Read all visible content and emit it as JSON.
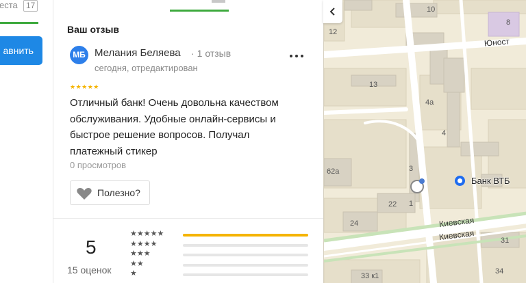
{
  "left_panel": {
    "tab_label": "еста",
    "tab_count": "17",
    "action_button": "авнить"
  },
  "review": {
    "section_title": "Ваш отзыв",
    "avatar_initials": "МБ",
    "author": "Мелания Беляева",
    "reviews_count": "1 отзыв",
    "date": "сегодня, отредактирован",
    "rating_stars": "★★★★★",
    "text": "Отличный банк! Очень довольна качеством обслуживания. Удобные онлайн-сервисы и быстрое решение вопросов. Получал платежный стикер",
    "views": "0 просмотров",
    "useful_button": "Полезно?"
  },
  "rating_summary": {
    "value": "5",
    "count_label": "15 оценок",
    "rows": [
      {
        "stars": "★★★★★",
        "fraction": 1.0
      },
      {
        "stars": "★★★★",
        "fraction": 0.0
      },
      {
        "stars": "★★★",
        "fraction": 0.0
      },
      {
        "stars": "★★",
        "fraction": 0.0
      },
      {
        "stars": "★",
        "fraction": 0.0
      }
    ]
  },
  "map": {
    "place_label": "Банк ВТБ",
    "street_1": "Киевская",
    "street_2": "Киевская",
    "street_3": "Юност",
    "buildings": [
      "12",
      "10",
      "8",
      "13",
      "4а",
      "4",
      "3",
      "62а",
      "1",
      "22",
      "24",
      "31",
      "34",
      "33 к1"
    ]
  },
  "colors": {
    "accent_green": "#3eaa3e",
    "button_blue": "#1e88e5",
    "star_yellow": "#f5b400",
    "marker_blue": "#1e6cf0"
  }
}
